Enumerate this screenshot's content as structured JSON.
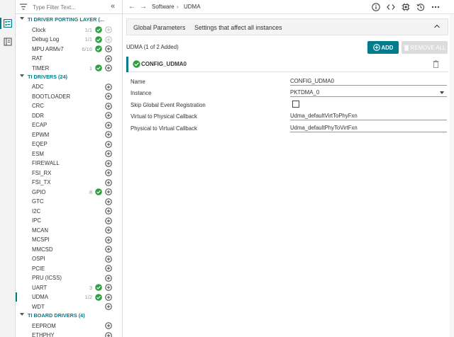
{
  "filter": {
    "placeholder": "Type Filter Text..."
  },
  "tree": {
    "categories": [
      {
        "label": "TI DRIVER PORTING LAYER (...",
        "items": [
          {
            "label": "Clock",
            "count": "1/1",
            "status": "ok",
            "add_enabled": false
          },
          {
            "label": "Debug Log",
            "count": "1/1",
            "status": "ok",
            "add_enabled": false
          },
          {
            "label": "MPU ARMv7",
            "count": "6/16",
            "status": "ok",
            "add_enabled": true
          },
          {
            "label": "RAT",
            "count": "",
            "status": "",
            "add_enabled": true
          },
          {
            "label": "TIMER",
            "count": "1",
            "status": "ok",
            "add_enabled": true
          }
        ]
      },
      {
        "label": "TI DRIVERS (24)",
        "items": [
          {
            "label": "ADC",
            "count": "",
            "status": "",
            "add_enabled": true
          },
          {
            "label": "BOOTLOADER",
            "count": "",
            "status": "",
            "add_enabled": true
          },
          {
            "label": "CRC",
            "count": "",
            "status": "",
            "add_enabled": true
          },
          {
            "label": "DDR",
            "count": "",
            "status": "",
            "add_enabled": true
          },
          {
            "label": "ECAP",
            "count": "",
            "status": "",
            "add_enabled": true
          },
          {
            "label": "EPWM",
            "count": "",
            "status": "",
            "add_enabled": true
          },
          {
            "label": "EQEP",
            "count": "",
            "status": "",
            "add_enabled": true
          },
          {
            "label": "ESM",
            "count": "",
            "status": "",
            "add_enabled": true
          },
          {
            "label": "FIREWALL",
            "count": "",
            "status": "",
            "add_enabled": true
          },
          {
            "label": "FSI_RX",
            "count": "",
            "status": "",
            "add_enabled": true
          },
          {
            "label": "FSI_TX",
            "count": "",
            "status": "",
            "add_enabled": true
          },
          {
            "label": "GPIO",
            "count": "8",
            "status": "ok",
            "add_enabled": true
          },
          {
            "label": "GTC",
            "count": "",
            "status": "",
            "add_enabled": true
          },
          {
            "label": "I2C",
            "count": "",
            "status": "",
            "add_enabled": true
          },
          {
            "label": "IPC",
            "count": "",
            "status": "",
            "add_enabled": true
          },
          {
            "label": "MCAN",
            "count": "",
            "status": "",
            "add_enabled": true
          },
          {
            "label": "MCSPI",
            "count": "",
            "status": "",
            "add_enabled": true
          },
          {
            "label": "MMCSD",
            "count": "",
            "status": "",
            "add_enabled": true
          },
          {
            "label": "OSPI",
            "count": "",
            "status": "",
            "add_enabled": true
          },
          {
            "label": "PCIE",
            "count": "",
            "status": "",
            "add_enabled": true
          },
          {
            "label": "PRU (ICSS)",
            "count": "",
            "status": "",
            "add_enabled": true
          },
          {
            "label": "UART",
            "count": "3",
            "status": "ok",
            "add_enabled": true
          },
          {
            "label": "UDMA",
            "count": "1/2",
            "status": "ok",
            "add_enabled": true,
            "selected": true
          },
          {
            "label": "WDT",
            "count": "",
            "status": "",
            "add_enabled": true
          }
        ]
      },
      {
        "label": "TI BOARD DRIVERS (4)",
        "items": [
          {
            "label": "EEPROM",
            "count": "",
            "status": "",
            "add_enabled": true
          },
          {
            "label": "ETHPHY",
            "count": "",
            "status": "",
            "add_enabled": true
          }
        ]
      }
    ]
  },
  "topbar": {
    "breadcrumb": [
      "Software",
      "UDMA"
    ],
    "separator": "›",
    "icons": [
      "info-icon",
      "code-icon",
      "chip-icon",
      "history-icon",
      "more-icon"
    ]
  },
  "global_params": {
    "title": "Global Parameters",
    "description": "Settings that affect all instances"
  },
  "module": {
    "title": "UDMA (1 of 2 Added)",
    "add_label": "ADD",
    "remove_label": "REMOVE ALL",
    "instance_name": "CONFIG_UDMA0"
  },
  "properties": [
    {
      "label": "Name",
      "value": "CONFIG_UDMA0",
      "type": "text"
    },
    {
      "label": "Instance",
      "value": "PKTDMA_0",
      "type": "select"
    },
    {
      "label": "Skip Global Event Registration",
      "value": "",
      "type": "checkbox",
      "checked": false
    },
    {
      "label": "Virtual to Physical Callback",
      "value": "Udma_defaultVirtToPhyFxn",
      "type": "text"
    },
    {
      "label": "Physical to Virtual Callback",
      "value": "Udma_defaultPhyToVirtFxn",
      "type": "text"
    }
  ],
  "colors": {
    "accent": "#007c8c",
    "ok": "#2e9e3e",
    "border": "#dcdcdc"
  }
}
